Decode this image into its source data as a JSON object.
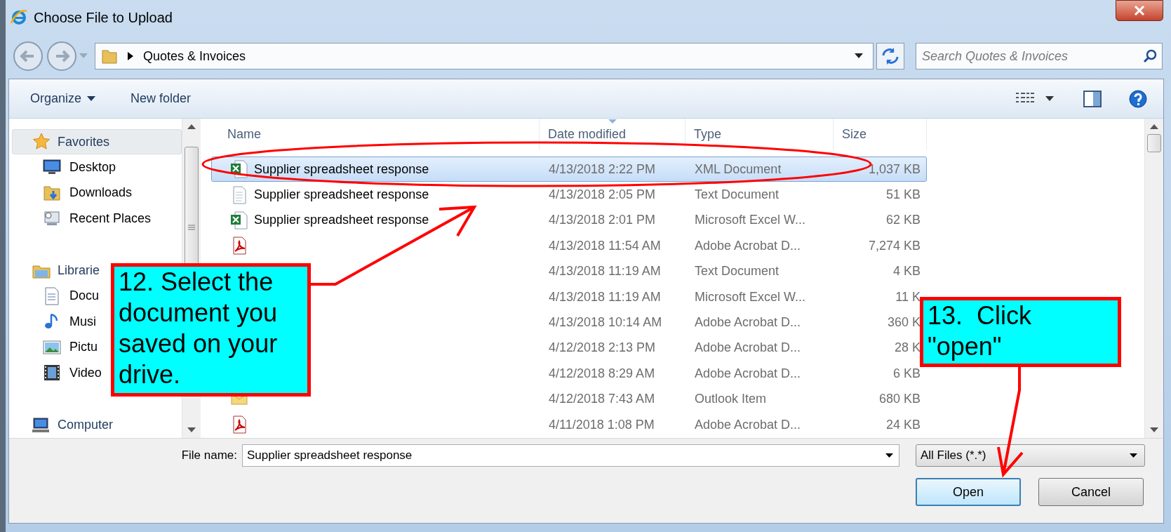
{
  "window": {
    "title": "Choose File to Upload"
  },
  "address_bar": {
    "path": "Quotes & Invoices"
  },
  "search": {
    "placeholder": "Search Quotes & Invoices"
  },
  "toolbar": {
    "buttons": [
      {
        "label": "Organize",
        "kind": "menu"
      },
      {
        "label": "New folder",
        "kind": "plain"
      }
    ]
  },
  "sidebar": {
    "groups": [
      {
        "label": "Favorites",
        "selected": true,
        "children": [
          {
            "label": "Desktop",
            "selected": false
          },
          {
            "label": "Downloads",
            "selected": false
          },
          {
            "label": "Recent Places",
            "selected": false
          }
        ]
      },
      {
        "label": "Librarie",
        "selected": false,
        "children": [
          {
            "label": "Docu",
            "selected": false
          },
          {
            "label": "Musi",
            "selected": false
          },
          {
            "label": "Pictu",
            "selected": false
          },
          {
            "label": "Video",
            "selected": false
          }
        ]
      },
      {
        "label": "Computer",
        "selected": false
      }
    ]
  },
  "file_list": {
    "columns": [
      {
        "label": "Name",
        "sorted": false
      },
      {
        "label": "Date modified",
        "sorted": true
      },
      {
        "label": "Type",
        "sorted": false
      },
      {
        "label": "Size",
        "sorted": false
      }
    ],
    "rows": [
      {
        "name": "Supplier spreadsheet response",
        "date": "4/13/2018 2:22 PM",
        "type": "XML Document",
        "size": "1,037 KB",
        "kind": "excel",
        "selected": true
      },
      {
        "name": "Supplier spreadsheet response",
        "date": "4/13/2018 2:05 PM",
        "type": "Text Document",
        "size": "51 KB",
        "kind": "text",
        "selected": false
      },
      {
        "name": "Supplier spreadsheet response",
        "date": "4/13/2018 2:01 PM",
        "type": "Microsoft Excel W...",
        "size": "62 KB",
        "kind": "excel",
        "selected": false
      },
      {
        "date": "4/13/2018 11:54 AM",
        "type": "Adobe Acrobat D...",
        "size": "7,274 KB",
        "kind": "pdf",
        "selected": false
      },
      {
        "date": "4/13/2018 11:19 AM",
        "type": "Text Document",
        "size": "4 KB",
        "selected": false
      },
      {
        "date": "4/13/2018 11:19 AM",
        "type": "Microsoft Excel W...",
        "size": "11 K",
        "selected": false
      },
      {
        "date": "4/13/2018 10:14 AM",
        "type": "Adobe Acrobat D...",
        "size": "360 K",
        "selected": false
      },
      {
        "date": "4/12/2018 2:13 PM",
        "type": "Adobe Acrobat D...",
        "size": "28 K",
        "selected": false
      },
      {
        "date": "4/12/2018 8:29 AM",
        "type": "Adobe Acrobat D...",
        "size": "6 KB",
        "selected": false
      },
      {
        "date": "4/12/2018 7:43 AM",
        "type": "Outlook Item",
        "size": "680 KB",
        "kind": "outlook",
        "selected": false
      },
      {
        "date": "4/11/2018 1:08 PM",
        "type": "Adobe Acrobat D...",
        "size": "24 KB",
        "kind": "pdf",
        "selected": false
      }
    ]
  },
  "footer": {
    "file_name_label": "File name:",
    "file_name": "Supplier spreadsheet response",
    "filter": "All Files (*.*)",
    "buttons": [
      {
        "label": "Open",
        "default": true
      },
      {
        "label": "Cancel",
        "default": false
      }
    ]
  },
  "annotations": [
    {
      "kind": "callout",
      "text": "12. Select the document you saved on your drive."
    },
    {
      "kind": "callout",
      "text": "13.  Click \"open\""
    }
  ]
}
